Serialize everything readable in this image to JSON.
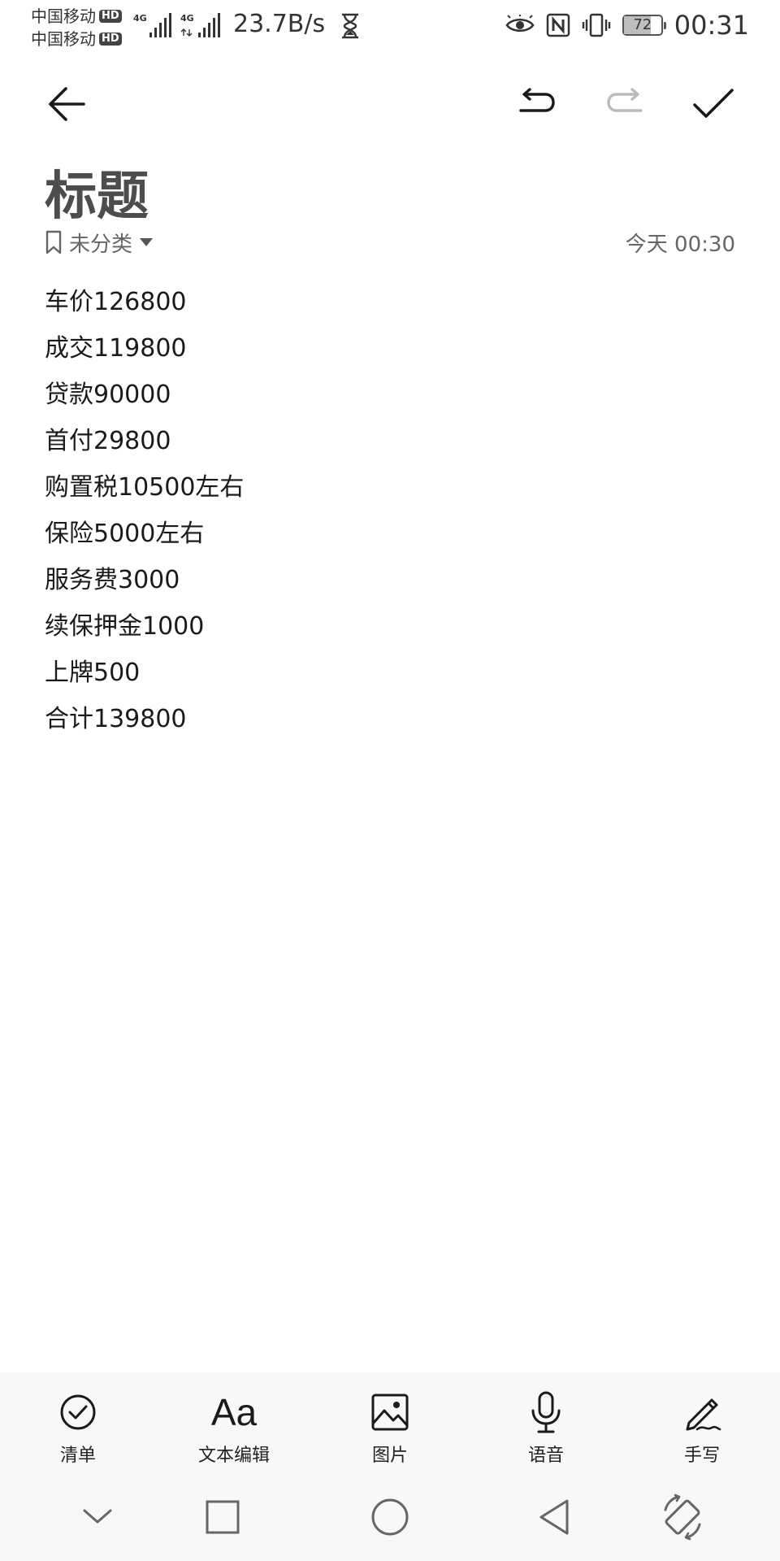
{
  "status_bar": {
    "carrier_1": "中国移动",
    "carrier_2": "中国移动",
    "hd_badge": "HD",
    "network_1": "4G",
    "network_2": "4G",
    "net_speed": "23.7B/s",
    "battery_level": "72",
    "time": "00:31"
  },
  "note": {
    "title": "标题",
    "category": "未分类",
    "date": "今天 00:30",
    "lines": [
      "车价126800",
      "成交119800",
      "贷款90000",
      "首付29800",
      "购置税10500左右",
      "保险5000左右",
      "服务费3000",
      "续保押金1000",
      "上牌500",
      "合计139800"
    ]
  },
  "bottom_tools": {
    "checklist": "清单",
    "text_edit": "文本编辑",
    "text_edit_glyph": "Aa",
    "image": "图片",
    "voice": "语音",
    "handwriting": "手写"
  },
  "colors": {
    "title": "#4d4d4d",
    "meta_text": "#666666",
    "body_text": "#1a1a1a",
    "redo_disabled": "#bbbbbb",
    "bottom_bg": "#f8f8f8"
  }
}
